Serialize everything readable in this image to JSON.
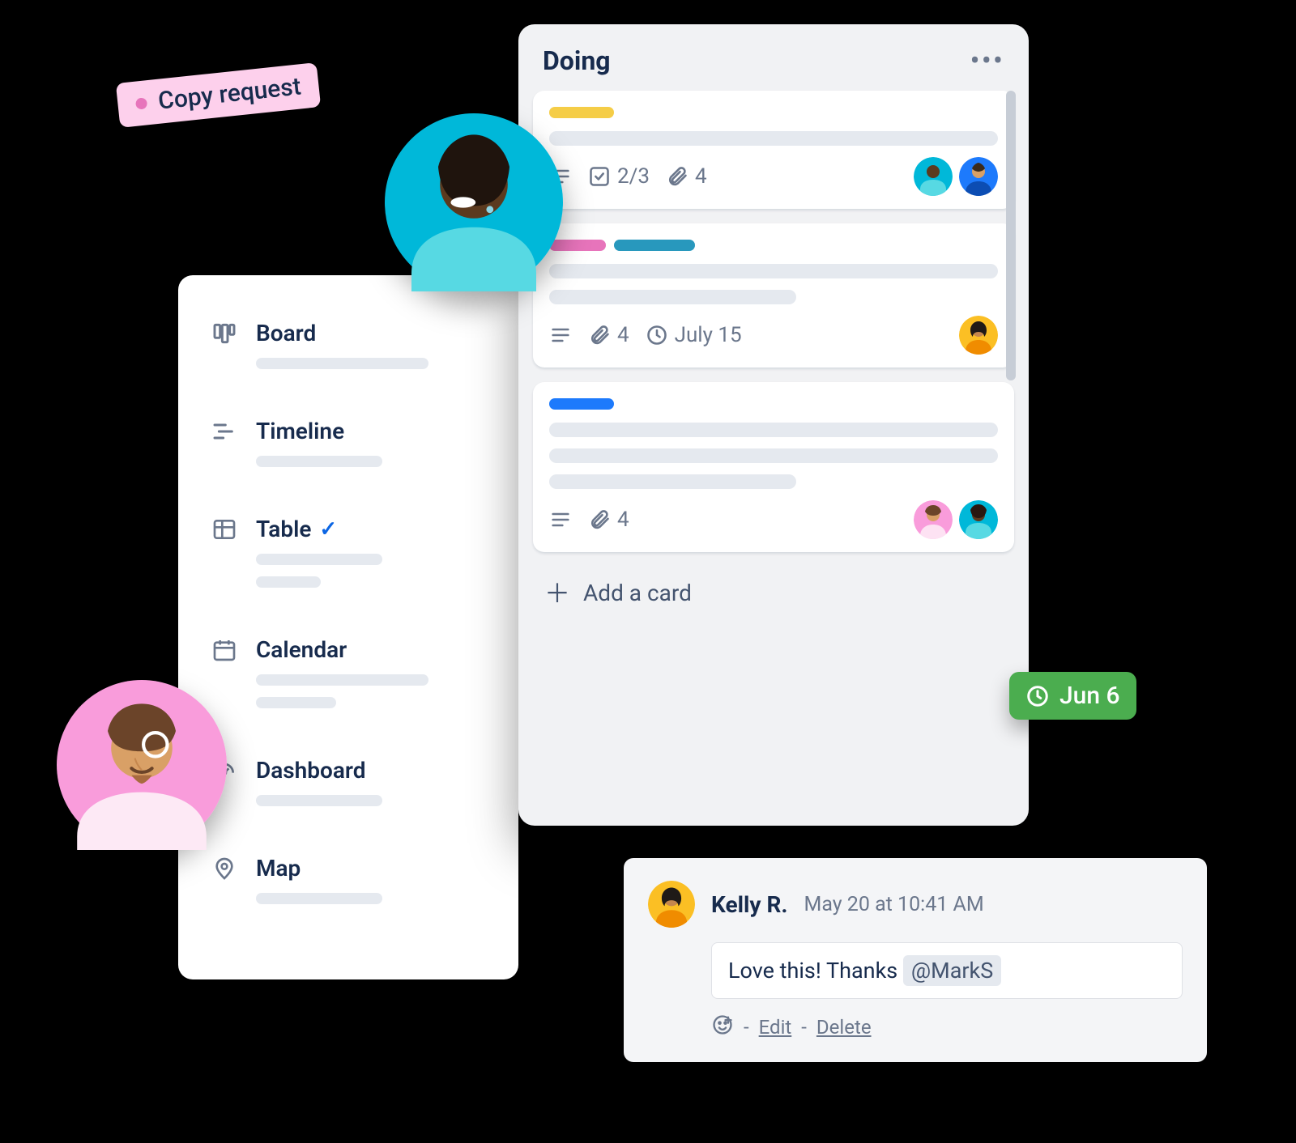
{
  "copy_request": {
    "label": "Copy request"
  },
  "views": {
    "items": [
      {
        "id": "board",
        "label": "Board",
        "checked": false
      },
      {
        "id": "timeline",
        "label": "Timeline",
        "checked": false
      },
      {
        "id": "table",
        "label": "Table",
        "checked": true
      },
      {
        "id": "calendar",
        "label": "Calendar",
        "checked": false
      },
      {
        "id": "dashboard",
        "label": "Dashboard",
        "checked": false
      },
      {
        "id": "map",
        "label": "Map",
        "checked": false
      }
    ]
  },
  "list": {
    "title": "Doing",
    "add_card": "Add a card",
    "cards": [
      {
        "checklist": "2/3",
        "attachments": "4"
      },
      {
        "attachments": "4",
        "due": "July 15"
      },
      {
        "attachments": "4"
      }
    ]
  },
  "due_badge": {
    "label": "Jun 6"
  },
  "comment": {
    "author": "Kelly R.",
    "time": "May 20 at 10:41 AM",
    "body_prefix": "Love this! Thanks ",
    "mention": "@MarkS",
    "edit": "Edit",
    "delete": "Delete",
    "sep": " - "
  }
}
